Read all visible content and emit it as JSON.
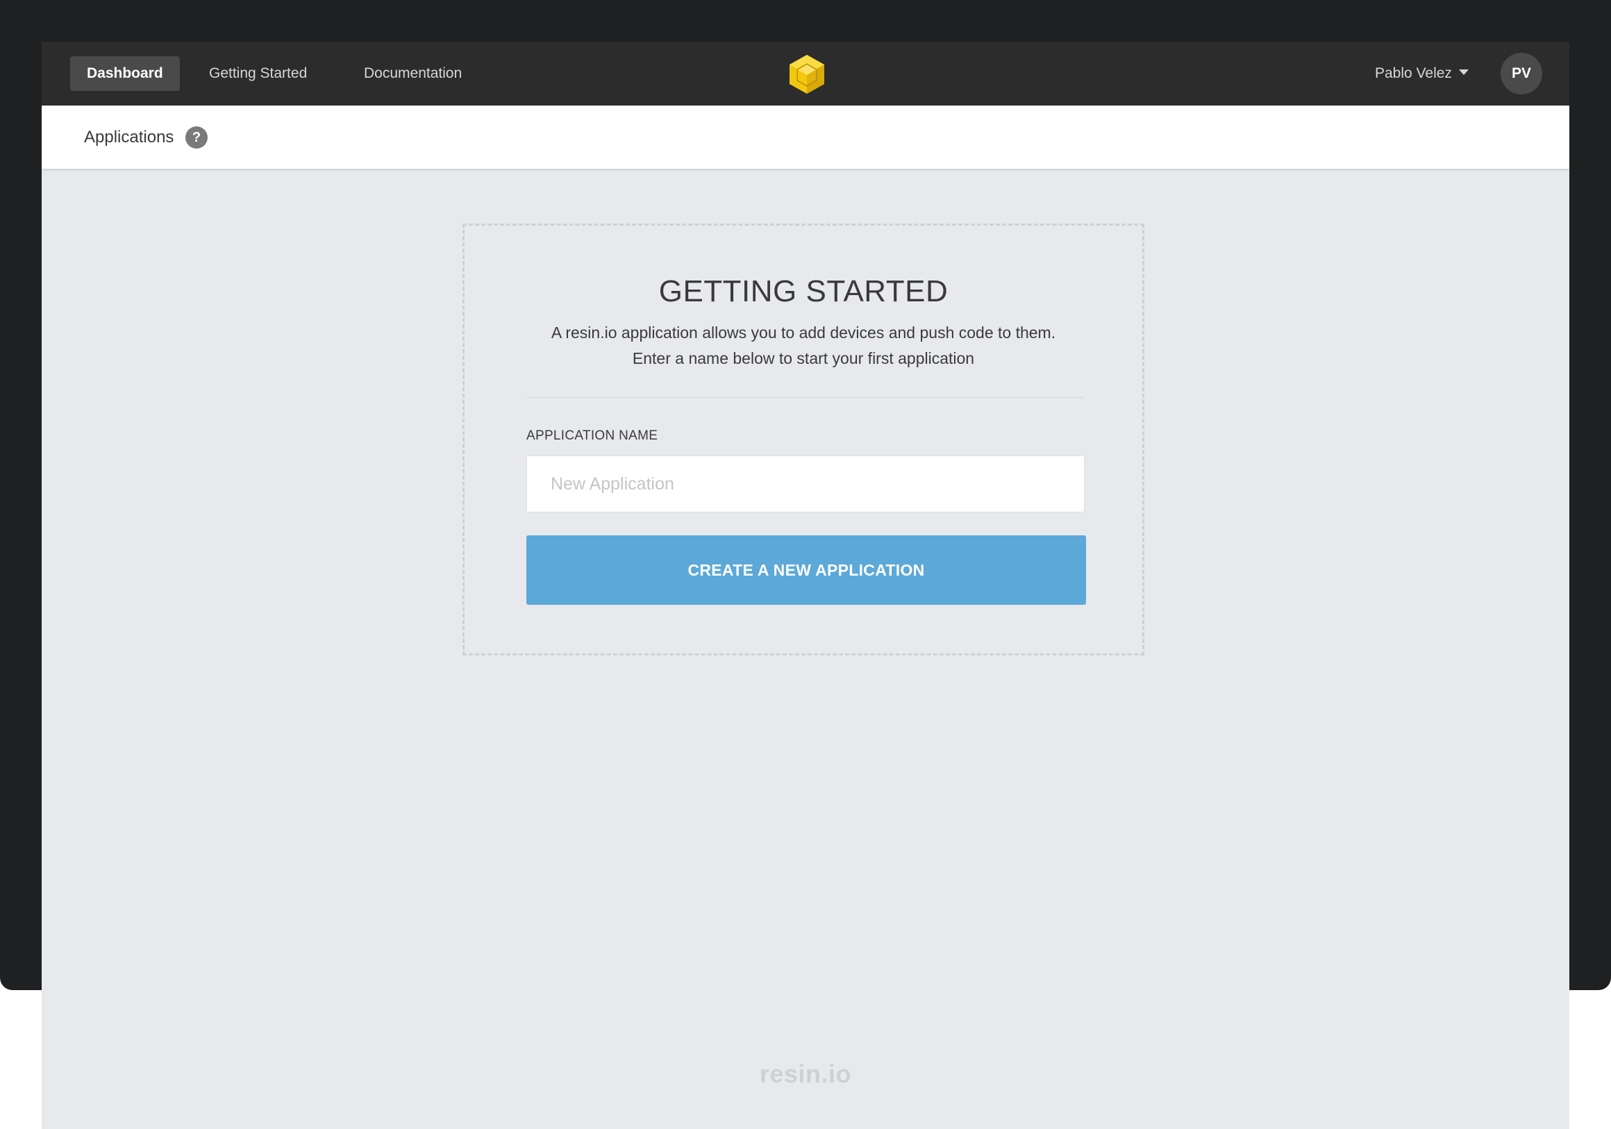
{
  "nav": {
    "items": [
      {
        "label": "Dashboard",
        "active": true
      },
      {
        "label": "Getting Started",
        "active": false
      },
      {
        "label": "Documentation",
        "active": false
      }
    ],
    "logo": "resin-cube-logo-icon",
    "user_name": "Pablo Velez",
    "user_initials": "PV"
  },
  "subheader": {
    "title": "Applications",
    "help_icon": "?"
  },
  "card": {
    "title": "GETTING STARTED",
    "description": "A resin.io application allows you to add devices and push code to them. Enter a name below to start your first application",
    "field_label": "APPLICATION NAME",
    "input_placeholder": "New Application",
    "input_value": "",
    "button_label": "CREATE A NEW APPLICATION"
  },
  "footer": {
    "brand": "resin.io"
  },
  "colors": {
    "navbar": "#2c2c2d",
    "accent_button": "#5ca8d8",
    "background": "#e8e9ec",
    "logo_yellow": "#f2c80f"
  }
}
